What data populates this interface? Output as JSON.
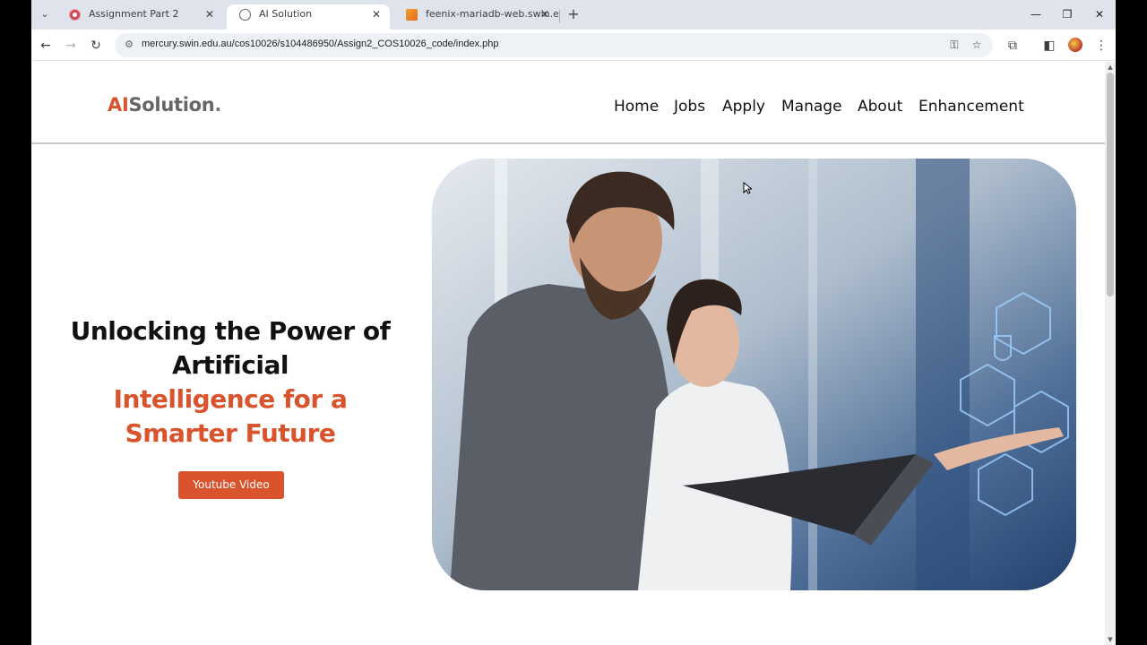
{
  "tabs": [
    {
      "title": "Assignment Part 2",
      "active": false
    },
    {
      "title": "AI Solution",
      "active": true
    },
    {
      "title": "feenix-mariadb-web.swin.edu.a",
      "active": false
    }
  ],
  "toolbar": {
    "url": "mercury.swin.edu.au/cos10026/s104486950/Assign2_COS10026_code/index.php"
  },
  "site": {
    "logo_ai": "AI",
    "logo_rest": "Solution",
    "logo_dot": ".",
    "nav": [
      "Home",
      "Jobs",
      "Apply",
      "Manage",
      "About",
      "Enhancement"
    ]
  },
  "hero": {
    "heading_line1": "Unlocking the Power of Artificial",
    "heading_line2": "Intelligence for a Smarter Future",
    "button_label": "Youtube Video",
    "image_description_icon": "photo"
  },
  "colors": {
    "accent": "#d9532c",
    "tabstrip": "#dfe3eb"
  }
}
